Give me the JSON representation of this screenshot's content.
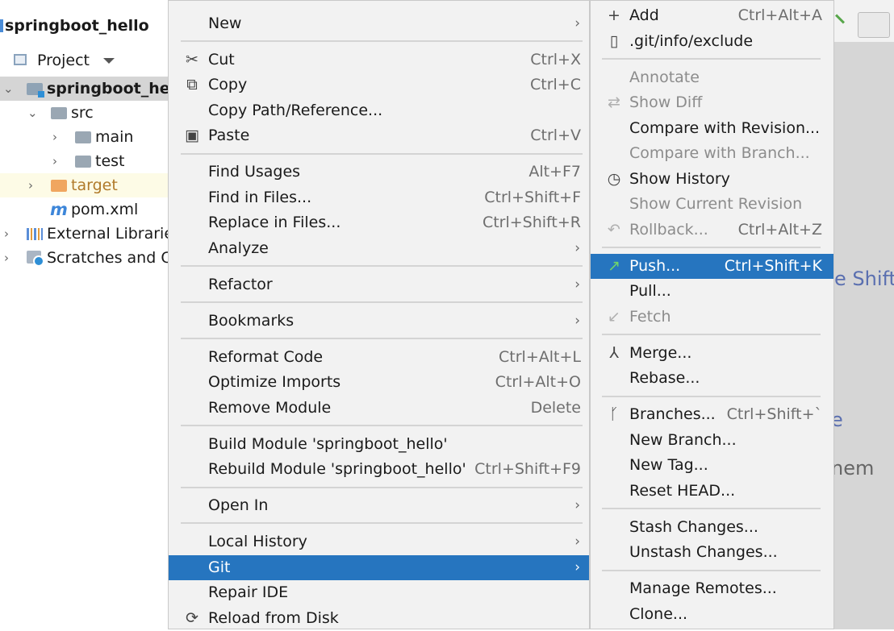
{
  "project": {
    "title": "springboot_hello",
    "view_selector": "Project",
    "tree": [
      {
        "label": "springboot_hello",
        "bold": true
      },
      {
        "label": "src"
      },
      {
        "label": "main"
      },
      {
        "label": "test"
      },
      {
        "label": "target"
      },
      {
        "label": "pom.xml"
      },
      {
        "label": "External Libraries"
      },
      {
        "label": "Scratches and Consoles"
      }
    ]
  },
  "editor_hints": [
    "e Shift",
    "e",
    "nem"
  ],
  "context_menu": {
    "items": [
      {
        "label": "New",
        "shortcut": "",
        "submenu": true,
        "icon": ""
      },
      {
        "label": "Cut",
        "shortcut": "Ctrl+X",
        "icon": "scissors-icon"
      },
      {
        "label": "Copy",
        "shortcut": "Ctrl+C",
        "icon": "copy-icon"
      },
      {
        "label": "Copy Path/Reference...",
        "shortcut": ""
      },
      {
        "label": "Paste",
        "shortcut": "Ctrl+V",
        "icon": "clipboard-icon"
      },
      {
        "label": "Find Usages",
        "shortcut": "Alt+F7"
      },
      {
        "label": "Find in Files...",
        "shortcut": "Ctrl+Shift+F"
      },
      {
        "label": "Replace in Files...",
        "shortcut": "Ctrl+Shift+R"
      },
      {
        "label": "Analyze",
        "shortcut": "",
        "submenu": true
      },
      {
        "label": "Refactor",
        "shortcut": "",
        "submenu": true
      },
      {
        "label": "Bookmarks",
        "shortcut": "",
        "submenu": true
      },
      {
        "label": "Reformat Code",
        "shortcut": "Ctrl+Alt+L"
      },
      {
        "label": "Optimize Imports",
        "shortcut": "Ctrl+Alt+O"
      },
      {
        "label": "Remove Module",
        "shortcut": "Delete"
      },
      {
        "label": "Build Module 'springboot_hello'",
        "shortcut": ""
      },
      {
        "label": "Rebuild Module 'springboot_hello'",
        "shortcut": "Ctrl+Shift+F9"
      },
      {
        "label": "Open In",
        "shortcut": "",
        "submenu": true
      },
      {
        "label": "Local History",
        "shortcut": "",
        "submenu": true
      },
      {
        "label": "Git",
        "shortcut": "",
        "submenu": true,
        "highlighted": true
      },
      {
        "label": "Repair IDE",
        "shortcut": ""
      },
      {
        "label": "Reload from Disk",
        "shortcut": "",
        "icon": "reload-icon"
      }
    ]
  },
  "git_menu": {
    "items": [
      {
        "label": "Add",
        "shortcut": "Ctrl+Alt+A",
        "icon": "plus-icon"
      },
      {
        "label": ".git/info/exclude",
        "shortcut": "",
        "icon": "file-icon"
      },
      {
        "label": "Annotate",
        "shortcut": "",
        "disabled": true
      },
      {
        "label": "Show Diff",
        "shortcut": "",
        "disabled": true,
        "icon": "diff-icon"
      },
      {
        "label": "Compare with Revision...",
        "shortcut": ""
      },
      {
        "label": "Compare with Branch...",
        "shortcut": "",
        "disabled": true
      },
      {
        "label": "Show History",
        "shortcut": "",
        "icon": "clock-icon"
      },
      {
        "label": "Show Current Revision",
        "shortcut": "",
        "disabled": true
      },
      {
        "label": "Rollback...",
        "shortcut": "Ctrl+Alt+Z",
        "disabled": true,
        "icon": "rollback-icon"
      },
      {
        "label": "Push...",
        "shortcut": "Ctrl+Shift+K",
        "highlighted": true,
        "icon": "push-arrow-icon"
      },
      {
        "label": "Pull...",
        "shortcut": ""
      },
      {
        "label": "Fetch",
        "shortcut": "",
        "disabled": true,
        "icon": "fetch-icon"
      },
      {
        "label": "Merge...",
        "shortcut": "",
        "icon": "merge-icon"
      },
      {
        "label": "Rebase...",
        "shortcut": ""
      },
      {
        "label": "Branches...",
        "shortcut": "Ctrl+Shift+`",
        "icon": "branch-icon"
      },
      {
        "label": "New Branch...",
        "shortcut": ""
      },
      {
        "label": "New Tag...",
        "shortcut": ""
      },
      {
        "label": "Reset HEAD...",
        "shortcut": ""
      },
      {
        "label": "Stash Changes...",
        "shortcut": ""
      },
      {
        "label": "Unstash Changes...",
        "shortcut": ""
      },
      {
        "label": "Manage Remotes...",
        "shortcut": ""
      },
      {
        "label": "Clone...",
        "shortcut": ""
      }
    ]
  },
  "colors": {
    "highlight": "#2675bf",
    "menu_bg": "#f2f2f2",
    "disabled_text": "#8c8c8c",
    "push_icon": "#4caf50"
  }
}
